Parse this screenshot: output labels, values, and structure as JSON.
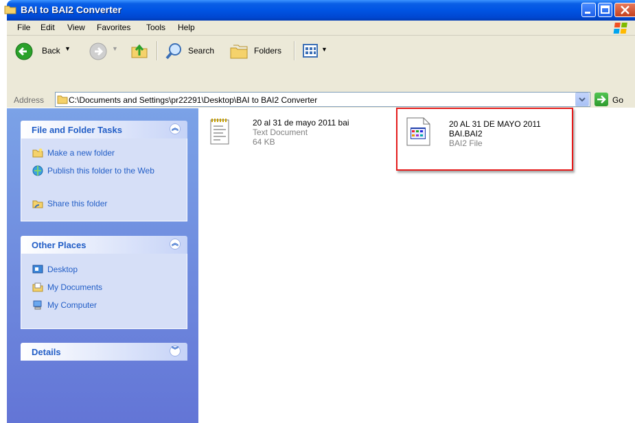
{
  "window": {
    "title": "BAI to BAI2 Converter"
  },
  "menu": [
    "File",
    "Edit",
    "View",
    "Favorites",
    "Tools",
    "Help"
  ],
  "toolbar": {
    "back_label": "Back",
    "search_label": "Search",
    "folders_label": "Folders"
  },
  "address": {
    "label": "Address",
    "path": "C:\\Documents and Settings\\pr22291\\Desktop\\BAI to BAI2 Converter",
    "go_label": "Go"
  },
  "tasks_panel": {
    "title": "File and Folder Tasks",
    "items": [
      "Make a new folder",
      "Publish this folder to the Web",
      "Share this folder"
    ]
  },
  "places_panel": {
    "title": "Other Places",
    "items": [
      "Desktop",
      "My Documents",
      "My Computer"
    ]
  },
  "details_panel": {
    "title": "Details"
  },
  "files": [
    {
      "name": "20 al 31 de mayo 2011 bai",
      "type": "Text Document",
      "size": "64 KB",
      "icon": "text-document-icon"
    },
    {
      "name_line1": "20 AL 31 DE MAYO 2011",
      "name_line2": "BAI.BAI2",
      "type": "BAI2 File",
      "icon": "bai2-file-icon",
      "highlighted": true
    }
  ],
  "colors": {
    "title_bar": "#0054e3",
    "task_pane": "#6f8fe0",
    "panel_body": "#d6dff7",
    "link": "#215dc6",
    "highlight": "#e51a1a"
  }
}
